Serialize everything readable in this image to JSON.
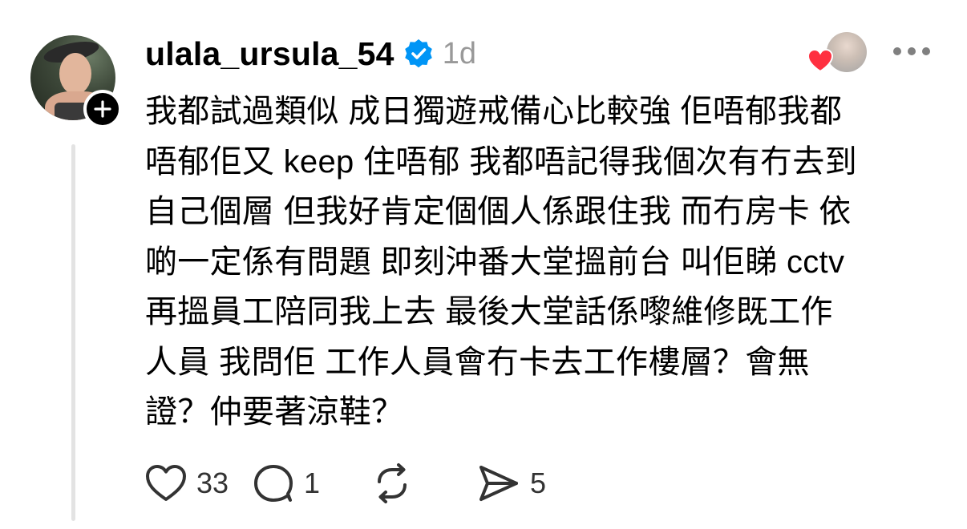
{
  "post": {
    "username": "ulala_ursula_54",
    "timestamp": "1d",
    "text": "我都試過類似 成日獨遊戒備心比較強 佢唔郁我都\n唔郁佢又 keep 住唔郁  我都唔記得我個次有冇去到\n自己個層 但我好肯定個個人係跟住我 而冇房卡 依\n啲一定係有問題 即刻沖番大堂搵前台 叫佢睇 cctv\n再搵員工陪同我上去 最後大堂話係嚟維修既工作\n人員 我問佢 工作人員會冇卡去工作樓層？會無\n證？仲要著涼鞋？",
    "stats": {
      "likes": "33",
      "replies": "1",
      "shares": "5"
    }
  },
  "colors": {
    "verified": "#0095f6",
    "heart": "#ff3040",
    "muted": "#999999",
    "thread_line": "#e3e3e3"
  },
  "icons": [
    "plus-icon",
    "verified-icon",
    "heart-icon",
    "more-icon",
    "like-icon",
    "reply-icon",
    "repost-icon",
    "share-icon"
  ]
}
